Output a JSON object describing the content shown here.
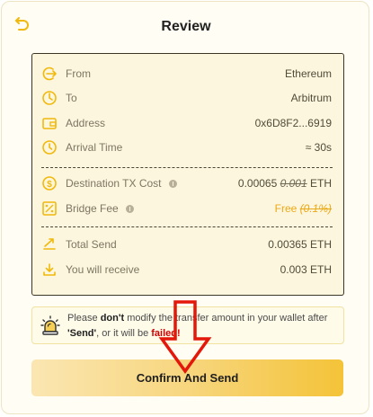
{
  "header": {
    "title": "Review",
    "back_icon": "back-arrow-icon"
  },
  "details": {
    "rows": [
      {
        "label": "From",
        "value": "Ethereum",
        "icon": "from-arrow-icon"
      },
      {
        "label": "To",
        "value": "Arbitrum",
        "icon": "power-icon"
      },
      {
        "label": "Address",
        "value": "0x6D8F2...6919",
        "icon": "wallet-icon"
      },
      {
        "label": "Arrival Time",
        "value": "≈ 30s",
        "icon": "clock-icon"
      }
    ],
    "cost": {
      "label": "Destination TX Cost",
      "value": "0.00065",
      "old_value": "0.001",
      "unit": "ETH",
      "icon": "dollar-icon"
    },
    "fee": {
      "label": "Bridge Fee",
      "value": "Free",
      "old_value": "(0.1%)",
      "icon": "percent-icon"
    },
    "totals": [
      {
        "label": "Total Send",
        "value": "0.00365 ETH",
        "icon": "send-arrow-icon"
      },
      {
        "label": "You will receive",
        "value": "0.003 ETH",
        "icon": "download-icon"
      }
    ]
  },
  "warning": {
    "icon": "alarm-icon",
    "pre": "Please ",
    "emph1": "don't",
    "mid": " modify the transfer amount in your wallet after ",
    "emph2": "'Send'",
    "mid2": ", or it will be ",
    "failed": "failed!"
  },
  "confirm": {
    "label": "Confirm And Send"
  },
  "colors": {
    "accent": "#f4c338",
    "icon": "#f0b90b",
    "annotation": "#e3170a",
    "fail": "#d40000"
  }
}
